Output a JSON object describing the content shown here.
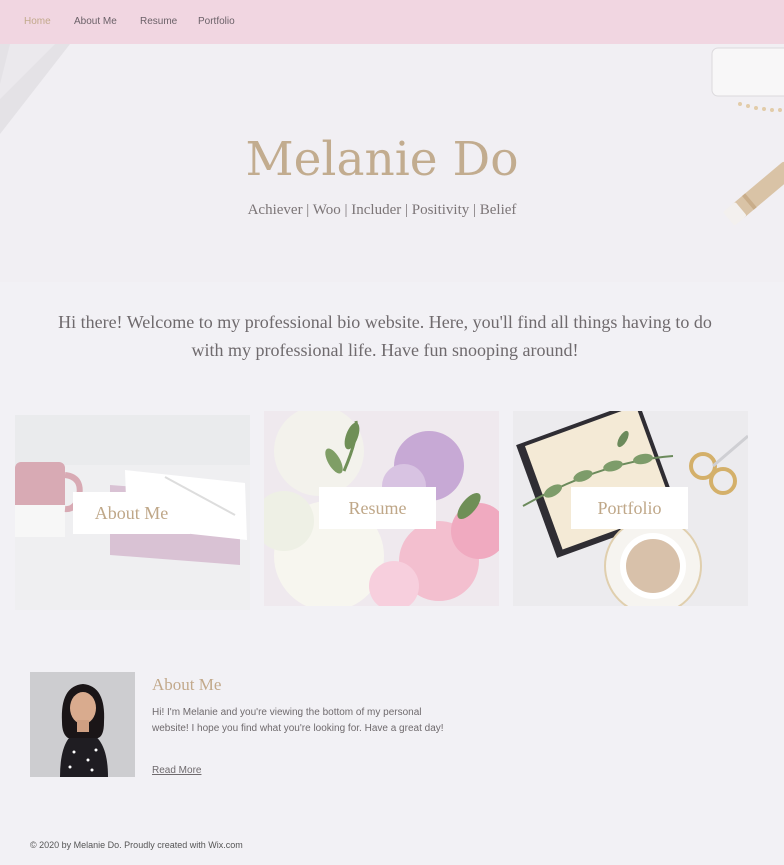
{
  "nav": {
    "items": [
      {
        "label": "Home",
        "active": true
      },
      {
        "label": "About Me",
        "active": false
      },
      {
        "label": "Resume",
        "active": false
      },
      {
        "label": "Portfolio",
        "active": false
      }
    ]
  },
  "hero": {
    "title": "Melanie Do",
    "subtitle": "Achiever | Woo | Includer | Positivity | Belief"
  },
  "intro": {
    "text": "Hi there! Welcome to my professional bio website. Here, you'll find all things having to do with my professional life. Have fun snooping around!"
  },
  "cards": [
    {
      "label": "About Me"
    },
    {
      "label": "Resume"
    },
    {
      "label": "Portfolio"
    }
  ],
  "about": {
    "title": "About Me",
    "body": "Hi! I'm Melanie and you're viewing the bottom of my personal website! I hope you find what you're looking for. Have a great day!",
    "link": "Read More"
  },
  "footer": {
    "text": "© 2020 by Melanie Do. Proudly created with Wix.com"
  },
  "colors": {
    "nav_bg": "#f1d6e1",
    "accent_gold": "#c2a98b",
    "page_bg": "#f2f1f5"
  }
}
